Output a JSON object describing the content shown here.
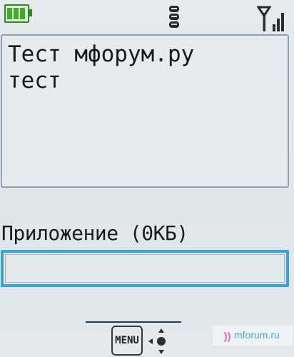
{
  "status_bar": {
    "battery_icon": "battery-full-icon",
    "battery_level": 1.0,
    "memory_icon": "phone-memory-icon",
    "signal_icon": "signal-strength-icon",
    "signal_bars": 3,
    "battery_color": "#39b025"
  },
  "message": {
    "text": "Тест мфорум.ру\nтест"
  },
  "attachment": {
    "label": "Приложение (0КБ)",
    "value": "",
    "accent_color": "#39a2dc"
  },
  "softkeys": {
    "menu_label": "MENU",
    "menu_icon": "menu-key-icon",
    "nav_icon": "navigation-key-icon"
  },
  "watermark": {
    "text": "mforum.ru",
    "icon": "mforum-logo-icon"
  }
}
